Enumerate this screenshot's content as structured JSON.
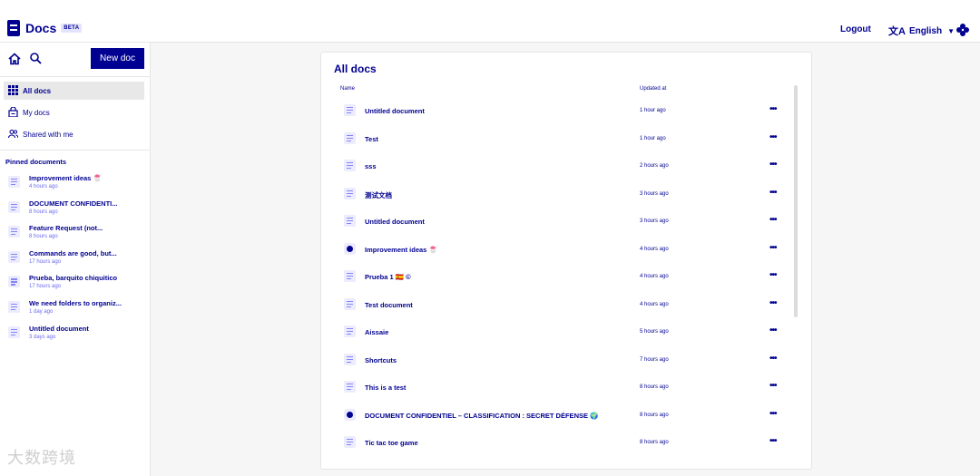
{
  "header": {
    "app_name": "Docs",
    "beta_badge": "BETA",
    "logout_label": "Logout",
    "language_label": "English",
    "language_icon": "translate-icon",
    "apps_icon": "gauffre-icon"
  },
  "sidebar": {
    "new_doc_label": "New doc",
    "nav": [
      {
        "label": "All docs",
        "icon": "grid-icon",
        "active": true
      },
      {
        "label": "My docs",
        "icon": "lock-doc-icon",
        "active": false
      },
      {
        "label": "Shared with me",
        "icon": "users-icon",
        "active": false
      }
    ],
    "pinned_title": "Pinned documents",
    "pinned": [
      {
        "title": "Improvement ideas 🍧",
        "time": "4 hours ago"
      },
      {
        "title": "DOCUMENT CONFIDENTI...",
        "time": "8 hours ago"
      },
      {
        "title": "Feature Request (not...",
        "time": "8 hours ago"
      },
      {
        "title": "Commands are good, but...",
        "time": "17 hours ago"
      },
      {
        "title": "Prueba, barquito chiquitico",
        "time": "17 hours ago"
      },
      {
        "title": "We need folders to organiz...",
        "time": "1 day ago"
      },
      {
        "title": "Untitled document",
        "time": "3 days ago"
      }
    ]
  },
  "main": {
    "title": "All docs",
    "col_name": "Name",
    "col_updated": "Updated at",
    "docs": [
      {
        "title": "Untitled document",
        "updated": "1 hour ago",
        "shared": false
      },
      {
        "title": "Test",
        "updated": "1 hour ago",
        "shared": false
      },
      {
        "title": "sss",
        "updated": "2 hours ago",
        "shared": false
      },
      {
        "title": "测试文档",
        "updated": "3 hours ago",
        "shared": false
      },
      {
        "title": "Untitled document",
        "updated": "3 hours ago",
        "shared": false
      },
      {
        "title": "Improvement ideas 🍧",
        "updated": "4 hours ago",
        "shared": true
      },
      {
        "title": "Prueba 1 🇪🇸 ©",
        "updated": "4 hours ago",
        "shared": false
      },
      {
        "title": "Test document",
        "updated": "4 hours ago",
        "shared": false
      },
      {
        "title": "Aissaie",
        "updated": "5 hours ago",
        "shared": false
      },
      {
        "title": "Shortcuts",
        "updated": "7 hours ago",
        "shared": false
      },
      {
        "title": "This is a test",
        "updated": "8 hours ago",
        "shared": false
      },
      {
        "title": "DOCUMENT CONFIDENTIEL – CLASSIFICATION : SECRET DÉFENSE 🌍",
        "updated": "8 hours ago",
        "shared": true
      },
      {
        "title": "Tic tac toe game",
        "updated": "8 hours ago",
        "shared": false
      }
    ],
    "more_label": "•••"
  },
  "watermark": "大数跨境",
  "colors": {
    "brand": "#000091",
    "muted_text": "#6a6af4",
    "active_nav_bg": "#e8e8e8",
    "background": "#f6f6f6"
  }
}
